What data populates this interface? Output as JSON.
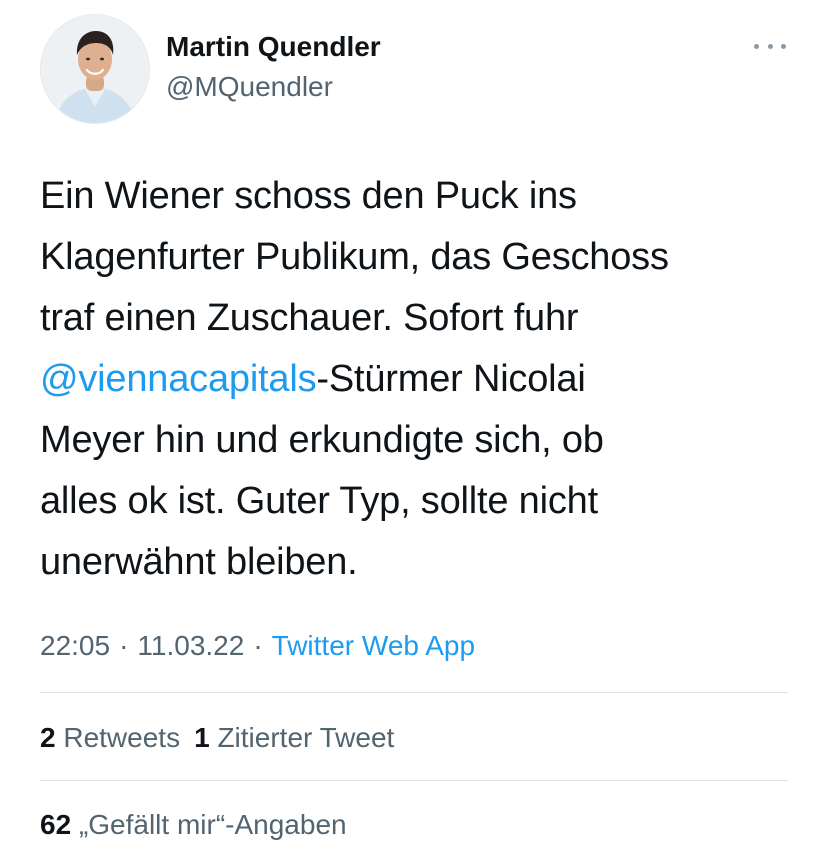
{
  "author": {
    "display_name": "Martin Quendler",
    "handle": "@MQuendler",
    "avatar_icon": "profile-photo"
  },
  "more_icon": "more-horizontal-icon",
  "tweet": {
    "lines": [
      {
        "text": "Ein Wiener schoss den Puck ins"
      },
      {
        "text": "Klagenfurter Publikum, das Geschoss"
      },
      {
        "text": "traf einen Zuschauer. Sofort fuhr"
      },
      {
        "mention": "@viennacapitals",
        "text": "-Stürmer Nicolai"
      },
      {
        "text": "Meyer hin und erkundigte sich, ob"
      },
      {
        "text": "alles ok ist. Guter Typ, sollte nicht"
      },
      {
        "text": "unerwähnt bleiben."
      }
    ]
  },
  "meta": {
    "time": "22:05",
    "separator": "·",
    "date": "11.03.22",
    "source": "Twitter Web App"
  },
  "stats": {
    "retweets_count": "2",
    "retweets_label": "Retweets",
    "quotes_count": "1",
    "quotes_label": "Zitierter Tweet",
    "likes_count": "62",
    "likes_label": "„Gefällt mir“-Angaben"
  },
  "colors": {
    "text": "#0f1419",
    "secondary": "#536471",
    "accent": "#1d9bf0",
    "divider": "#dde3e7"
  }
}
